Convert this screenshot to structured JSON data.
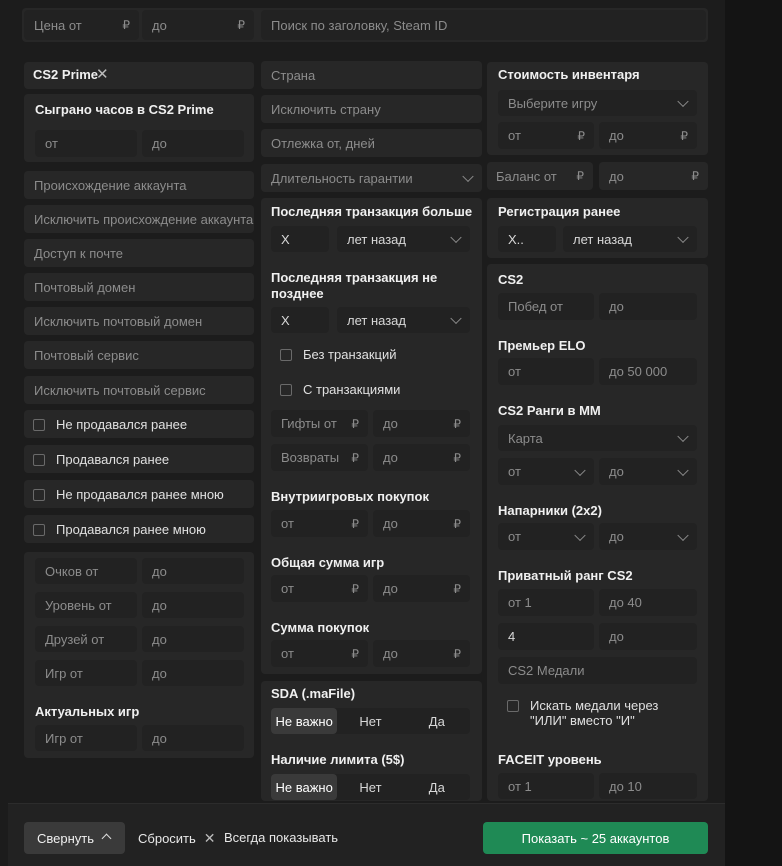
{
  "top": {
    "price_from": "Цена от",
    "price_to": "до",
    "currency": "₽",
    "search_placeholder": "Поиск по заголовку, Steam ID"
  },
  "col1": {
    "cs2prime_tag": "CS2 Prime",
    "hours_title": "Сыграно часов в CS2 Prime",
    "hours_from": "от",
    "hours_to": "до",
    "fields": [
      "Происхождение аккаунта",
      "Исключить происхождение аккаунта",
      "Доступ к почте",
      "Почтовый домен",
      "Исключить почтовый домен",
      "Почтовый сервис",
      "Исключить почтовый сервис"
    ],
    "checks": [
      "Не продавался ранее",
      "Продавался ранее",
      "Не продавался ранее мною",
      "Продавался ранее мною"
    ],
    "ranges": [
      {
        "from": "Очков от",
        "to": "до"
      },
      {
        "from": "Уровень от",
        "to": "до"
      },
      {
        "from": "Друзей от",
        "to": "до"
      },
      {
        "from": "Игр от",
        "to": "до"
      }
    ],
    "actual_title": "Актуальных игр",
    "actual_from": "Игр от",
    "actual_to": "до"
  },
  "col2": {
    "country": "Страна",
    "exclude_country": "Исключить страну",
    "rest": "Отлежка от, дней",
    "warranty": "Длительность гарантии",
    "last_tx_title": "Последняя транзакция больше",
    "last_tx_x": "X",
    "last_tx_unit": "лет назад",
    "last_tx2_title": "Последняя транзакция не позднее",
    "last_tx2_x": "X",
    "last_tx2_unit": "лет назад",
    "no_tx": "Без транзакций",
    "with_tx": "С транзакциями",
    "gifts_from": "Гифты от",
    "gifts_to": "до",
    "refunds_from": "Возвраты с",
    "refunds_to": "до",
    "ingame_title": "Внутриигровых покупок",
    "ingame_from": "от",
    "ingame_to": "до",
    "games_sum_title": "Общая сумма игр",
    "games_sum_from": "от",
    "games_sum_to": "до",
    "purchases_title": "Сумма покупок",
    "purchases_from": "от",
    "purchases_to": "до",
    "sda_title": "SDA (.maFile)",
    "limit_title": "Наличие лимита (5$)",
    "opt_any": "Не важно",
    "opt_no": "Нет",
    "opt_yes": "Да",
    "currency": "₽"
  },
  "col3": {
    "inv_title": "Стоимость инвентаря",
    "inv_game": "Выберите игру",
    "inv_from": "от",
    "inv_to": "до",
    "balance_from": "Баланс от",
    "balance_to": "до",
    "reg_title": "Регистрация ранее",
    "reg_x": "X..",
    "reg_unit": "лет назад",
    "cs2_title": "CS2",
    "wins_from": "Побед от",
    "wins_to": "до",
    "elo_title": "Премьер ELO",
    "elo_from": "от",
    "elo_to": "до 50 000",
    "mm_title": "CS2 Ранги в ММ",
    "mm_map": "Карта",
    "mm_from": "от",
    "mm_to": "до",
    "wingman_title": "Напарники (2x2)",
    "wingman_from": "от",
    "wingman_to": "до",
    "private_title": "Приватный ранг CS2",
    "private_from": "от 1",
    "private_to": "до 40",
    "private_val": "4",
    "private_to2": "до",
    "medals": "CS2 Медали",
    "medals_or": "Искать медали через \"ИЛИ\" вместо \"И\"",
    "faceit_title": "FACEIT уровень",
    "faceit_from": "от 1",
    "faceit_to": "до 10",
    "currency": "₽"
  },
  "footer": {
    "collapse": "Свернуть",
    "reset": "Сбросить",
    "always_show": "Всегда показывать",
    "show_button": "Показать ~ 25 аккаунтов"
  },
  "colors": {
    "accent": "#1f8a55",
    "panel": "#272727",
    "field": "#222222",
    "background": "#1c1c1c"
  }
}
